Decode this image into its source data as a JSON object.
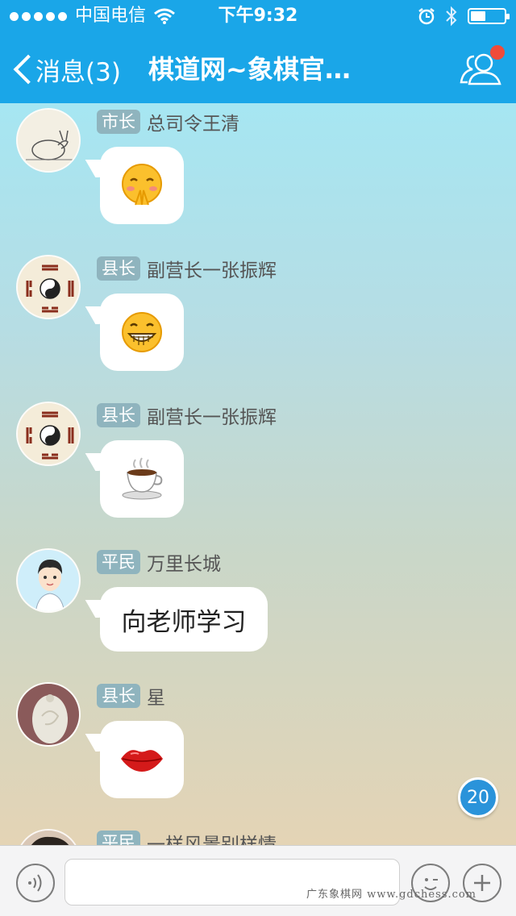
{
  "status_bar": {
    "carrier": "中国电信",
    "time": "下午9:32"
  },
  "nav": {
    "back_label": "消息(3)",
    "title": "棋道网~象棋官…"
  },
  "messages": [
    {
      "rank": "市长",
      "sender": "总司令王清",
      "content_type": "emoji",
      "emoji_name": "blushing-praying-face-icon",
      "avatar": "rabbit-drawing"
    },
    {
      "rank": "县长",
      "sender": "副营长一张振辉",
      "content_type": "emoji",
      "emoji_name": "grinning-face-icon",
      "avatar": "bagua-symbol"
    },
    {
      "rank": "县长",
      "sender": "副营长一张振辉",
      "content_type": "emoji",
      "emoji_name": "coffee-cup-icon",
      "avatar": "bagua-symbol"
    },
    {
      "rank": "平民",
      "sender": "万里长城",
      "content_type": "text",
      "text": "向老师学习",
      "avatar": "cartoon-boy"
    },
    {
      "rank": "县长",
      "sender": "星",
      "content_type": "emoji",
      "emoji_name": "red-lips-icon",
      "avatar": "jade-carving"
    },
    {
      "rank": "平民",
      "sender": "一样风景别样情",
      "content_type": "partial",
      "avatar": "person-photo"
    }
  ],
  "unread_badge": "20",
  "watermark": "广东象棋网 www.gdchess.com",
  "colors": {
    "header": "#1aa6e8",
    "rank_badge": "#8fb4be",
    "unread_badge": "#2a93da",
    "notification_dot": "#f04b3a"
  }
}
